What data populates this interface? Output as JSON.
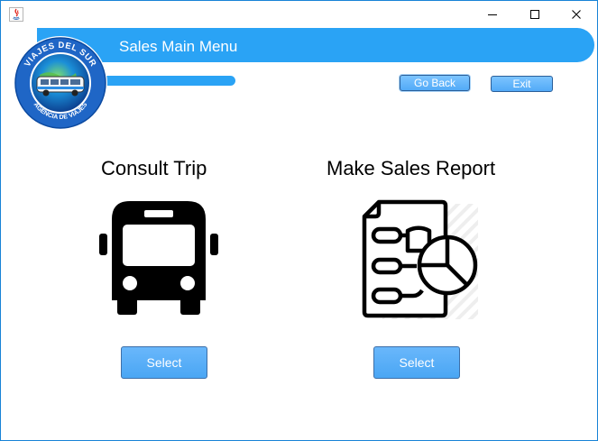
{
  "window": {
    "controls": {
      "minimize_icon": "minimize-icon",
      "maximize_icon": "maximize-icon",
      "close_icon": "close-icon"
    }
  },
  "header": {
    "title": "Sales Main Menu",
    "logo": {
      "top_text": "VIAJES DEL SUR",
      "bottom_text": "AGENCIA DE VIAJES"
    }
  },
  "nav": {
    "go_back_label": "Go Back",
    "exit_label": "Exit"
  },
  "options": [
    {
      "heading": "Consult Trip",
      "icon": "bus-icon",
      "button_label": "Select"
    },
    {
      "heading": "Make Sales Report",
      "icon": "sales-report-icon",
      "button_label": "Select"
    }
  ],
  "colors": {
    "accent": "#2aa3f5",
    "button": "#52aaf7",
    "window_border": "#1883d7"
  }
}
